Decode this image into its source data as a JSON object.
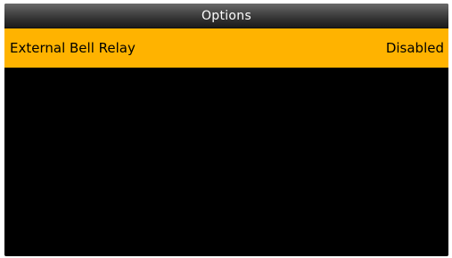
{
  "screen": {
    "title": "Options"
  },
  "options": [
    {
      "label": "External Bell Relay",
      "value": "Disabled",
      "selected": true
    }
  ],
  "colors": {
    "background": "#000000",
    "selection_highlight": "#ffb300",
    "title_text": "#ffffff"
  }
}
